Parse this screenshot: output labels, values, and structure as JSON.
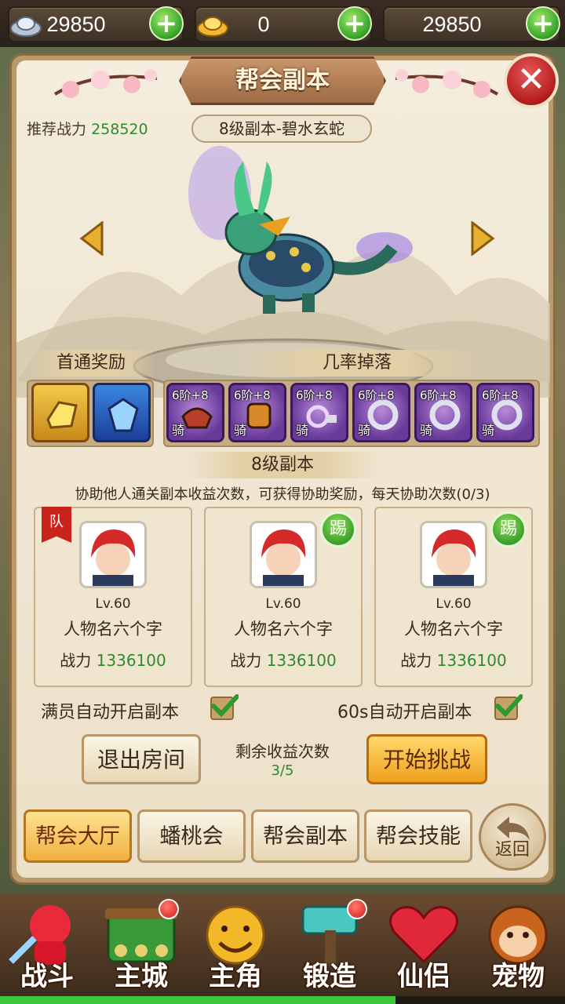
{
  "currency": [
    {
      "icon": "silver-ingot-icon",
      "value": "29850"
    },
    {
      "icon": "gold-ingot-icon",
      "value": "0"
    },
    {
      "icon": "blank-currency",
      "value": "29850"
    }
  ],
  "panel": {
    "title": "帮会副本",
    "recommend_label": "推荐战力",
    "recommend_value": "258520",
    "stage_name": "8级副本-碧水玄蛇"
  },
  "rewards": {
    "first_clear_label": "首通奖励",
    "drop_label": "几率掉落",
    "drops": [
      {
        "level": "6阶+8",
        "tag": "骑"
      },
      {
        "level": "6阶+8",
        "tag": "骑"
      },
      {
        "level": "6阶+8",
        "tag": "骑"
      },
      {
        "level": "6阶+8",
        "tag": "骑"
      },
      {
        "level": "6阶+8",
        "tag": "骑"
      },
      {
        "level": "6阶+8",
        "tag": "骑"
      }
    ]
  },
  "stage": {
    "header": "8级副本",
    "assist_text": "协助他人通关副本收益次数，可获得协助奖励，每天协助次数(0/3)"
  },
  "members": [
    {
      "badge": "队",
      "level": "Lv.60",
      "name": "人物名六个字",
      "power_label": "战力",
      "power": "1336100"
    },
    {
      "badge": "踢",
      "level": "Lv.60",
      "name": "人物名六个字",
      "power_label": "战力",
      "power": "1336100"
    },
    {
      "badge": "踢",
      "level": "Lv.60",
      "name": "人物名六个字",
      "power_label": "战力",
      "power": "1336100"
    }
  ],
  "options": {
    "auto_full": "满员自动开启副本",
    "auto_60s": "60s自动开启副本"
  },
  "actions": {
    "exit": "退出房间",
    "remain_label": "剩余收益次数",
    "remain_value": "3/5",
    "start": "开始挑战"
  },
  "tabs": [
    "帮会大厅",
    "蟠桃会",
    "帮会副本",
    "帮会技能"
  ],
  "back_label": "返回",
  "nav": [
    {
      "label": "战斗",
      "icon": "fighter-icon",
      "dot": false
    },
    {
      "label": "主城",
      "icon": "city-gate-icon",
      "dot": true
    },
    {
      "label": "主角",
      "icon": "hero-face-icon",
      "dot": false
    },
    {
      "label": "锻造",
      "icon": "hammer-icon",
      "dot": true
    },
    {
      "label": "仙侣",
      "icon": "heart-icon",
      "dot": false
    },
    {
      "label": "宠物",
      "icon": "monkey-icon",
      "dot": false
    }
  ],
  "colors": {
    "accent_green": "#2f8a2f",
    "title_brown": "#9c6a44",
    "active_tab": "#f0b040"
  }
}
